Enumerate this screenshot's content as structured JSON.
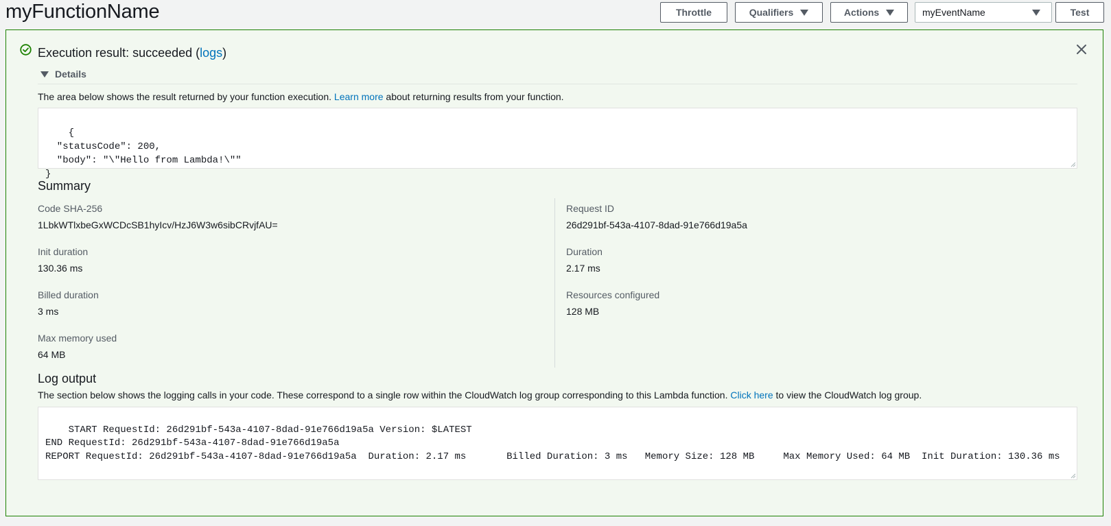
{
  "header": {
    "function_name": "myFunctionName",
    "throttle_label": "Throttle",
    "qualifiers_label": "Qualifiers",
    "actions_label": "Actions",
    "event_select_value": "myEventName",
    "test_label": "Test"
  },
  "result": {
    "title_prefix": "Execution result: succeeded (",
    "logs_link": "logs",
    "title_suffix": ")",
    "details_label": "Details",
    "desc_prefix": "The area below shows the result returned by your function execution. ",
    "learn_more_link": "Learn more",
    "desc_suffix": " about returning results from your function.",
    "output_json": "{\n  \"statusCode\": 200,\n  \"body\": \"\\\"Hello from Lambda!\\\"\"\n}"
  },
  "summary": {
    "heading": "Summary",
    "code_sha_label": "Code SHA-256",
    "code_sha_value": "1LbkWTlxbeGxWCDcSB1hyIcv/HzJ6W3w6sibCRvjfAU=",
    "request_id_label": "Request ID",
    "request_id_value": "26d291bf-543a-4107-8dad-91e766d19a5a",
    "init_duration_label": "Init duration",
    "init_duration_value": "130.36 ms",
    "duration_label": "Duration",
    "duration_value": "2.17 ms",
    "billed_duration_label": "Billed duration",
    "billed_duration_value": "3 ms",
    "resources_label": "Resources configured",
    "resources_value": "128 MB",
    "max_memory_label": "Max memory used",
    "max_memory_value": "64 MB"
  },
  "log": {
    "heading": "Log output",
    "desc_prefix": "The section below shows the logging calls in your code. These correspond to a single row within the CloudWatch log group corresponding to this Lambda function. ",
    "click_here_link": "Click here",
    "desc_suffix": " to view the CloudWatch log group.",
    "output": "START RequestId: 26d291bf-543a-4107-8dad-91e766d19a5a Version: $LATEST\nEND RequestId: 26d291bf-543a-4107-8dad-91e766d19a5a\nREPORT RequestId: 26d291bf-543a-4107-8dad-91e766d19a5a\tDuration: 2.17 ms\tBilled Duration: 3 ms\tMemory Size: 128 MB\tMax Memory Used: 64 MB\tInit Duration: 130.36 ms"
  },
  "colors": {
    "success_green": "#1d8102",
    "panel_bg": "#f2f8f0",
    "link_blue": "#0073bb"
  },
  "icons": {
    "status": "check-circle-icon",
    "close": "close-icon",
    "dropdown": "caret-down-icon"
  }
}
